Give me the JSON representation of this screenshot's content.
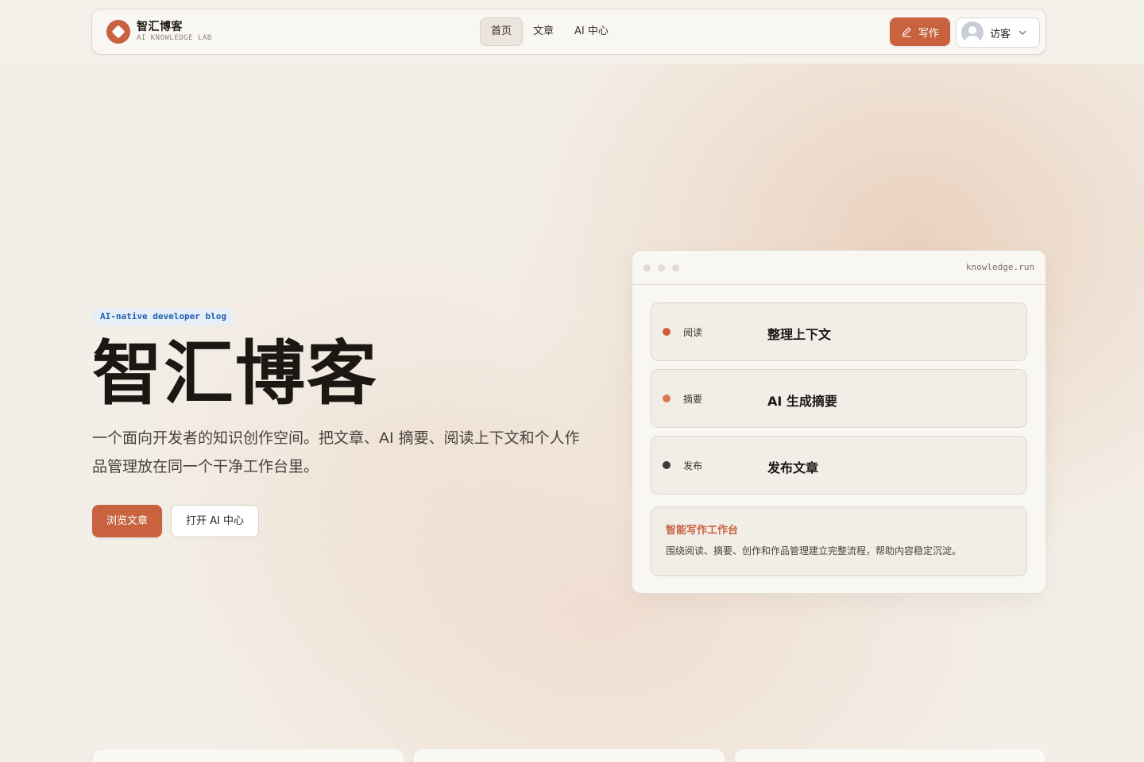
{
  "brand": {
    "title": "智汇博客",
    "subtitle": "AI KNOWLEDGE LAB",
    "accent": "#c8623f"
  },
  "nav": {
    "tabs": [
      {
        "label": "首页",
        "active": true
      },
      {
        "label": "文章",
        "active": false
      },
      {
        "label": "AI 中心",
        "active": false
      }
    ],
    "write_label": "写作",
    "user_label": "访客"
  },
  "hero": {
    "tagline": "AI-native developer blog",
    "title": "智汇博客",
    "description": "一个面向开发者的知识创作空间。把文章、AI 摘要、阅读上下文和个人作品管理放在同一个干净工作台里。",
    "primary_button": "浏览文章",
    "secondary_button": "打开 AI 中心"
  },
  "panel": {
    "url": "knowledge.run",
    "steps": [
      {
        "label": "阅读",
        "title": "整理上下文",
        "dot_color": "#d0603c"
      },
      {
        "label": "摘要",
        "title": "AI 生成摘要",
        "dot_color": "#e0784e"
      },
      {
        "label": "发布",
        "title": "发布文章",
        "dot_color": "#3e3a36"
      }
    ],
    "note": {
      "title": "智能写作工作台",
      "text": "围绕阅读、摘要、创作和作品管理建立完整流程，帮助内容稳定沉淀。"
    }
  },
  "icons": {
    "logo": "diamond-logo-icon",
    "write": "pen-icon",
    "user": "avatar-icon",
    "dropdown": "chevron-down-icon"
  }
}
